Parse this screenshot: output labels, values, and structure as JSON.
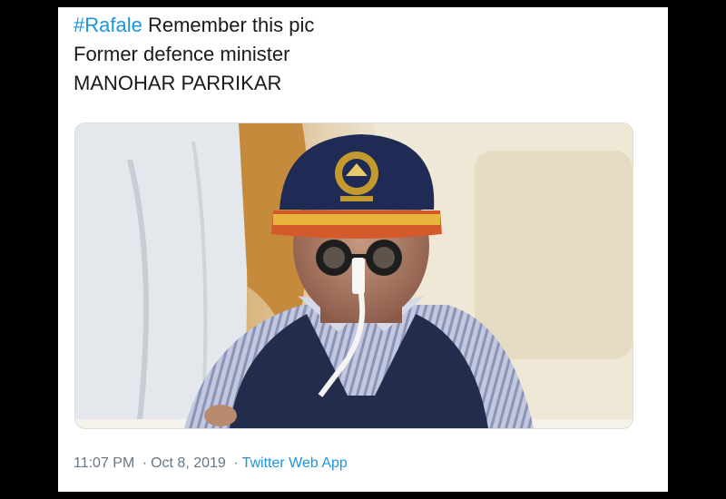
{
  "tweet": {
    "hashtag": "#Rafale",
    "line1_rest": " Remember this pic",
    "line2": "Former defence minister",
    "line3": "MANOHAR PARRIKAR",
    "time": "11:07 PM",
    "separator": "·",
    "date": "Oct 8, 2019",
    "source": "Twitter Web App"
  },
  "media": {
    "type": "photo",
    "subject": "man in navy cap and sweater vest with nasal tube"
  },
  "colors": {
    "link": "#1b95e0",
    "text": "#1a1a1a",
    "meta": "#657786",
    "background": "#000000",
    "card": "#ffffff"
  }
}
